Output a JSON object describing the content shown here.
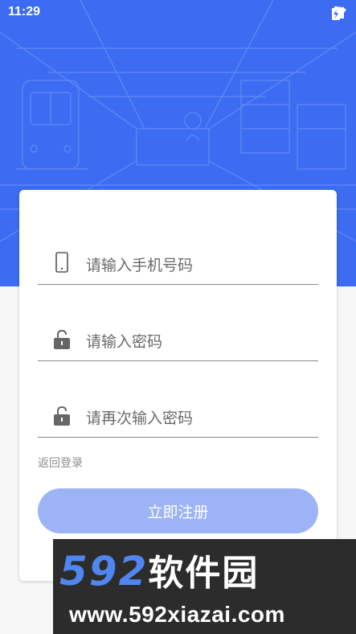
{
  "status_bar": {
    "time": "11:29",
    "icons": [
      "wifi-icon",
      "signal-icon",
      "battery-charging-icon"
    ]
  },
  "colors": {
    "hero_blue": "#3c6cf2",
    "button_blue": "#9cb4f6",
    "background": "#f7f7f7"
  },
  "form": {
    "phone_placeholder": "请输入手机号码",
    "password_placeholder": "请输入密码",
    "confirm_password_placeholder": "请再次输入密码",
    "back_to_login": "返回登录",
    "register_button": "立即注册"
  },
  "watermark": {
    "logo_number": "592",
    "logo_text": "软件园",
    "url": "www.592xiazai.com"
  }
}
